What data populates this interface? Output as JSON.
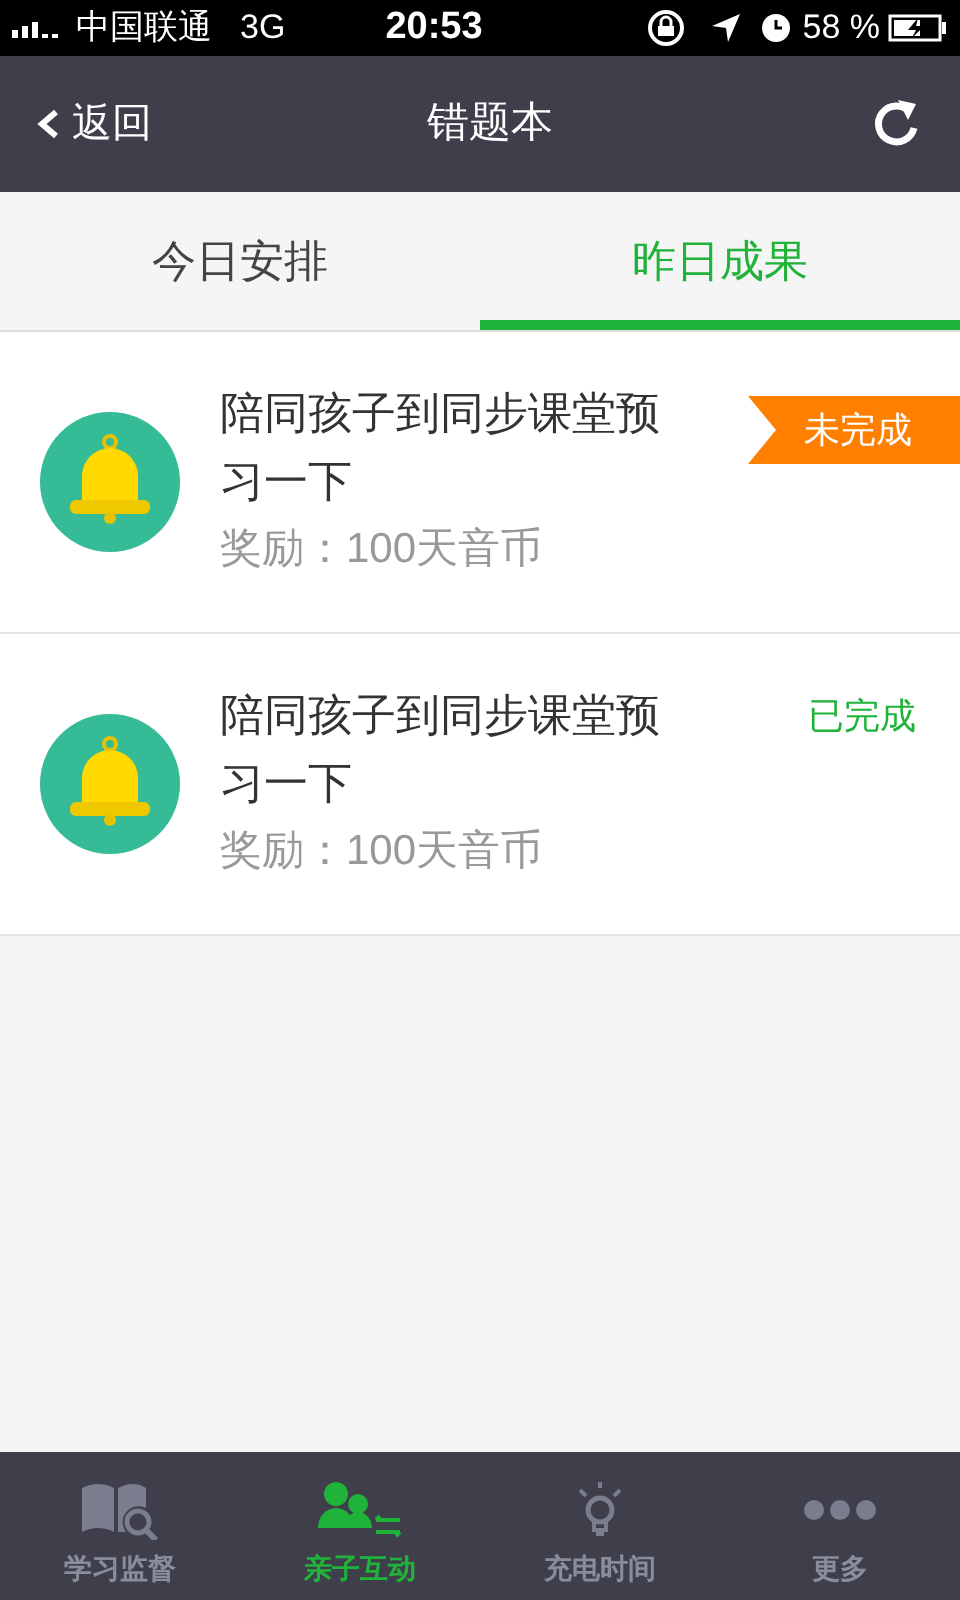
{
  "status_bar": {
    "carrier": "中国联通",
    "network": "3G",
    "time": "20:53",
    "battery": "58 %"
  },
  "nav": {
    "back": "返回",
    "title": "错题本"
  },
  "tabs": [
    {
      "label": "今日安排",
      "selected": false
    },
    {
      "label": "昨日成果",
      "selected": true
    }
  ],
  "tasks": [
    {
      "title": "陪同孩子到同步课堂预习一下",
      "reward": "奖励：100天音币",
      "status": "未完成",
      "completed": false
    },
    {
      "title": "陪同孩子到同步课堂预习一下",
      "reward": "奖励：100天音币",
      "status": "已完成",
      "completed": true
    }
  ],
  "bottom_tabs": [
    {
      "label": "学习监督",
      "kind": "book",
      "selected": false
    },
    {
      "label": "亲子互动",
      "kind": "people",
      "selected": true
    },
    {
      "label": "充电时间",
      "kind": "bulb",
      "selected": false
    },
    {
      "label": "更多",
      "kind": "more",
      "selected": false
    }
  ]
}
